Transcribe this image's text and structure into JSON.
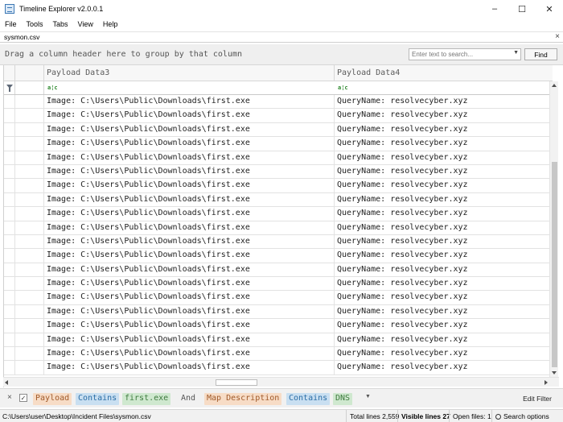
{
  "window": {
    "title": "Timeline Explorer v2.0.0.1"
  },
  "menu": [
    "File",
    "Tools",
    "Tabs",
    "View",
    "Help"
  ],
  "file_tab": {
    "label": "sysmon.csv",
    "close_glyph": "×"
  },
  "group_bar": {
    "hint": "Drag a column header here to group by that column",
    "search_placeholder": "Enter text to search...",
    "find_label": "Find"
  },
  "grid": {
    "columns": [
      "Payload Data3",
      "Payload Data4"
    ],
    "filter_glyph": "a¦c",
    "rows": [
      [
        "Image: C:\\Users\\Public\\Downloads\\first.exe",
        "QueryName: resolvecyber.xyz"
      ],
      [
        "Image: C:\\Users\\Public\\Downloads\\first.exe",
        "QueryName: resolvecyber.xyz"
      ],
      [
        "Image: C:\\Users\\Public\\Downloads\\first.exe",
        "QueryName: resolvecyber.xyz"
      ],
      [
        "Image: C:\\Users\\Public\\Downloads\\first.exe",
        "QueryName: resolvecyber.xyz"
      ],
      [
        "Image: C:\\Users\\Public\\Downloads\\first.exe",
        "QueryName: resolvecyber.xyz"
      ],
      [
        "Image: C:\\Users\\Public\\Downloads\\first.exe",
        "QueryName: resolvecyber.xyz"
      ],
      [
        "Image: C:\\Users\\Public\\Downloads\\first.exe",
        "QueryName: resolvecyber.xyz"
      ],
      [
        "Image: C:\\Users\\Public\\Downloads\\first.exe",
        "QueryName: resolvecyber.xyz"
      ],
      [
        "Image: C:\\Users\\Public\\Downloads\\first.exe",
        "QueryName: resolvecyber.xyz"
      ],
      [
        "Image: C:\\Users\\Public\\Downloads\\first.exe",
        "QueryName: resolvecyber.xyz"
      ],
      [
        "Image: C:\\Users\\Public\\Downloads\\first.exe",
        "QueryName: resolvecyber.xyz"
      ],
      [
        "Image: C:\\Users\\Public\\Downloads\\first.exe",
        "QueryName: resolvecyber.xyz"
      ],
      [
        "Image: C:\\Users\\Public\\Downloads\\first.exe",
        "QueryName: resolvecyber.xyz"
      ],
      [
        "Image: C:\\Users\\Public\\Downloads\\first.exe",
        "QueryName: resolvecyber.xyz"
      ],
      [
        "Image: C:\\Users\\Public\\Downloads\\first.exe",
        "QueryName: resolvecyber.xyz"
      ],
      [
        "Image: C:\\Users\\Public\\Downloads\\first.exe",
        "QueryName: resolvecyber.xyz"
      ],
      [
        "Image: C:\\Users\\Public\\Downloads\\first.exe",
        "QueryName: resolvecyber.xyz"
      ],
      [
        "Image: C:\\Users\\Public\\Downloads\\first.exe",
        "QueryName: resolvecyber.xyz"
      ],
      [
        "Image: C:\\Users\\Public\\Downloads\\first.exe",
        "QueryName: resolvecyber.xyz"
      ],
      [
        "Image: C:\\Users\\Public\\Downloads\\first.exe",
        "QueryName: resolvecyber.xyz"
      ]
    ]
  },
  "filter_bar": {
    "close_glyph": "×",
    "checked_glyph": "✓",
    "cond1": {
      "field": "Payload",
      "op": "Contains",
      "value": "first.exe"
    },
    "joiner": "And",
    "cond2": {
      "field": "Map Description",
      "op": "Contains",
      "value": "DNS"
    },
    "edit_label": "Edit Filter"
  },
  "status": {
    "path": "C:\\Users\\user\\Desktop\\Incident Files\\sysmon.csv",
    "total": "Total lines 2,559",
    "visible": "Visible lines 27",
    "open": "Open files: 1",
    "search_options": "Search options"
  },
  "colors": {
    "chip_field_bg": "#f7dcc6",
    "chip_op_bg": "#c9dff1",
    "chip_value_bg": "#cfe8cf",
    "abc_icon": "#2f8a2f"
  },
  "icons": [
    "app-icon",
    "minimize-icon",
    "maximize-icon",
    "close-icon",
    "filter-funnel-icon",
    "abc-filter-icon",
    "dropdown-icon",
    "search-options-icon"
  ]
}
